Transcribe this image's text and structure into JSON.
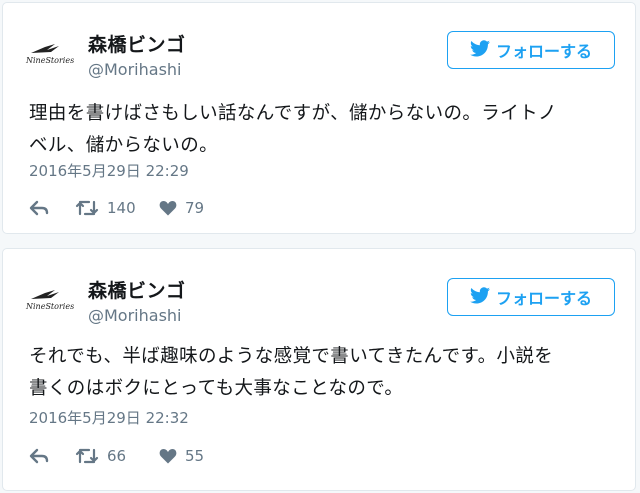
{
  "colors": {
    "accent": "#1da1f2",
    "secondary_text": "#657786",
    "border": "#e1e8ed"
  },
  "tweets": [
    {
      "author_name": "森橋ビンゴ",
      "handle": "@Morihashi",
      "avatar_logo_text": "NineStories",
      "follow_label": "フォローする",
      "text_line_1": "理由を書けばさもしい話なんですが、儲からないの。ライトノ",
      "text_line_2": "ベル、儲からないの。",
      "timestamp": "2016年5月29日 22:29",
      "retweet_count": "140",
      "like_count": "79",
      "icons": [
        "twitter-bird-icon",
        "reply-icon",
        "retweet-icon",
        "heart-icon"
      ]
    },
    {
      "author_name": "森橋ビンゴ",
      "handle": "@Morihashi",
      "avatar_logo_text": "NineStories",
      "follow_label": "フォローする",
      "text_line_1": "それでも、半ば趣味のような感覚で書いてきたんです。小説を",
      "text_line_2": "書くのはボクにとっても大事なことなので。",
      "timestamp": "2016年5月29日 22:32",
      "retweet_count": "66",
      "like_count": "55",
      "icons": [
        "twitter-bird-icon",
        "reply-icon",
        "retweet-icon",
        "heart-icon"
      ]
    }
  ]
}
